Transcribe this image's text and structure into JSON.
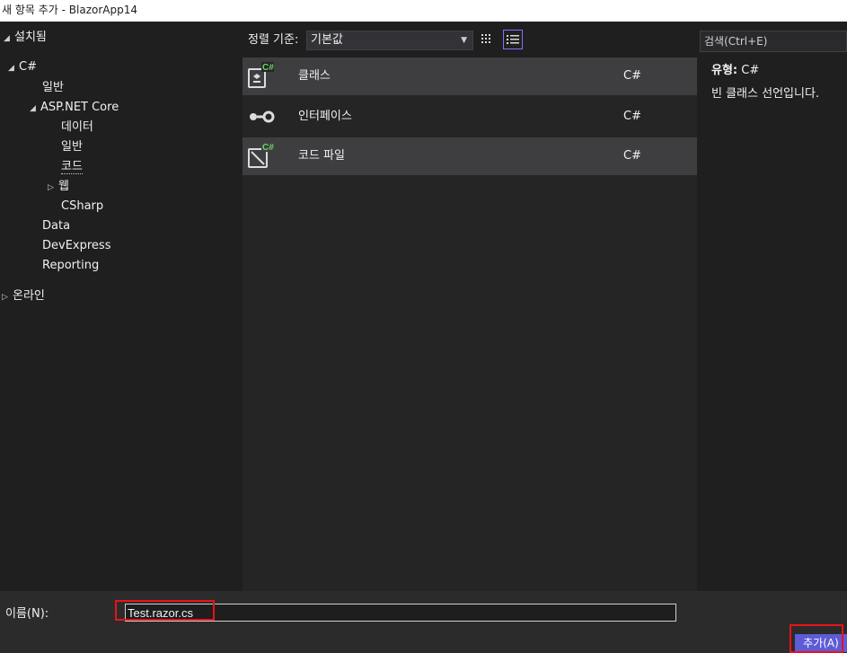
{
  "window": {
    "title": "새 항목 추가 - BlazorApp14"
  },
  "tree": {
    "installed": "설치됨",
    "csharp": "C#",
    "general": "일반",
    "aspnet_core": "ASP.NET Core",
    "data_ko": "데이터",
    "general2": "일반",
    "code": "코드",
    "web": "웹",
    "csharp_folder": "CSharp",
    "data": "Data",
    "devexpress": "DevExpress",
    "reporting": "Reporting",
    "online": "온라인"
  },
  "toolbar": {
    "sort_label": "정렬 기준:",
    "sort_value": "기본값",
    "search_placeholder": "검색(Ctrl+E)"
  },
  "templates": [
    {
      "name": "클래스",
      "lang": "C#",
      "icon": "class-icon"
    },
    {
      "name": "인터페이스",
      "lang": "C#",
      "icon": "interface-icon"
    },
    {
      "name": "코드 파일",
      "lang": "C#",
      "icon": "code-file-icon"
    }
  ],
  "description": {
    "type_label": "유형:",
    "type_value": "C#",
    "text": "빈 클래스 선언입니다."
  },
  "bottom": {
    "name_label": "이름(N):",
    "name_value": "Test.razor.cs",
    "add_button": "추가(A)"
  },
  "colors": {
    "accent": "#5e5bd6",
    "highlight_box": "#e8131b",
    "icon_green": "#6fd36b"
  }
}
